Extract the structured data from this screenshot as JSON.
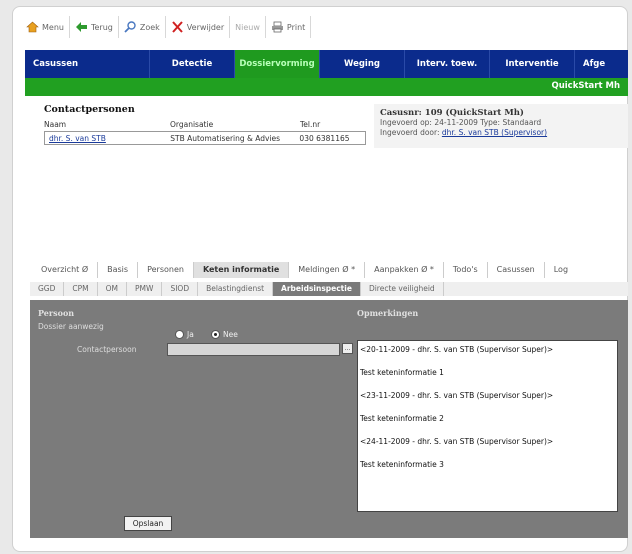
{
  "toolbar": {
    "menu": "Menu",
    "back": "Terug",
    "search": "Zoek",
    "delete": "Verwijder",
    "new": "Nieuw",
    "print": "Print"
  },
  "nav": {
    "items": [
      "Casussen",
      "Detectie",
      "Dossiervorming",
      "Weging",
      "Interv. toew.",
      "Interventie",
      "Afge"
    ],
    "active": "Dossiervorming"
  },
  "subbar": {
    "label": "QuickStart Mh"
  },
  "contacts": {
    "title": "Contactpersonen",
    "headers": [
      "Naam",
      "Organisatie",
      "Tel.nr"
    ],
    "rows": [
      {
        "name": "dhr. S. van STB",
        "org": "STB Automatisering & Advies",
        "phone": "030 6381165"
      }
    ]
  },
  "casus": {
    "title": "Casusnr: 109 (QuickStart Mh)",
    "line1": "Ingevoerd op: 24-11-2009 Type: Standaard",
    "line2_prefix": "Ingevoerd door:",
    "line2_link": "dhr. S. van STB (Supervisor)"
  },
  "tabs1": [
    "Overzicht Ø",
    "Basis",
    "Personen",
    "Keten informatie",
    "Meldingen Ø *",
    "Aanpakken Ø *",
    "Todo's",
    "Casussen",
    "Log"
  ],
  "tabs1_active": "Keten informatie",
  "tabs2": [
    "GGD",
    "CPM",
    "OM",
    "PMW",
    "SIOD",
    "Belastingdienst",
    "Arbeidsinspectie",
    "Directe veiligheid"
  ],
  "tabs2_active": "Arbeidsinspectie",
  "panel": {
    "section_left": "Persoon",
    "section_right": "Opmerkingen",
    "dossier_label": "Dossier aanwezig",
    "radio_yes": "Ja",
    "radio_no": "Nee",
    "radio_selected": "Nee",
    "contact_label": "Contactpersoon",
    "contact_value": "",
    "notes": [
      "<20-11-2009 - dhr. S. van STB (Supervisor Super)>",
      "Test keteninformatie 1",
      "<23-11-2009 - dhr. S. van STB (Supervisor Super)>",
      "Test keteninformatie 2",
      "<24-11-2009 - dhr. S. van STB (Supervisor Super)>",
      "Test keteninformatie 3"
    ],
    "save": "Opslaan"
  },
  "colors": {
    "nav_bg": "#0b2b8c",
    "nav_active": "#1f9a1f",
    "subbar": "#21a021",
    "panel": "#7b7b7b"
  }
}
